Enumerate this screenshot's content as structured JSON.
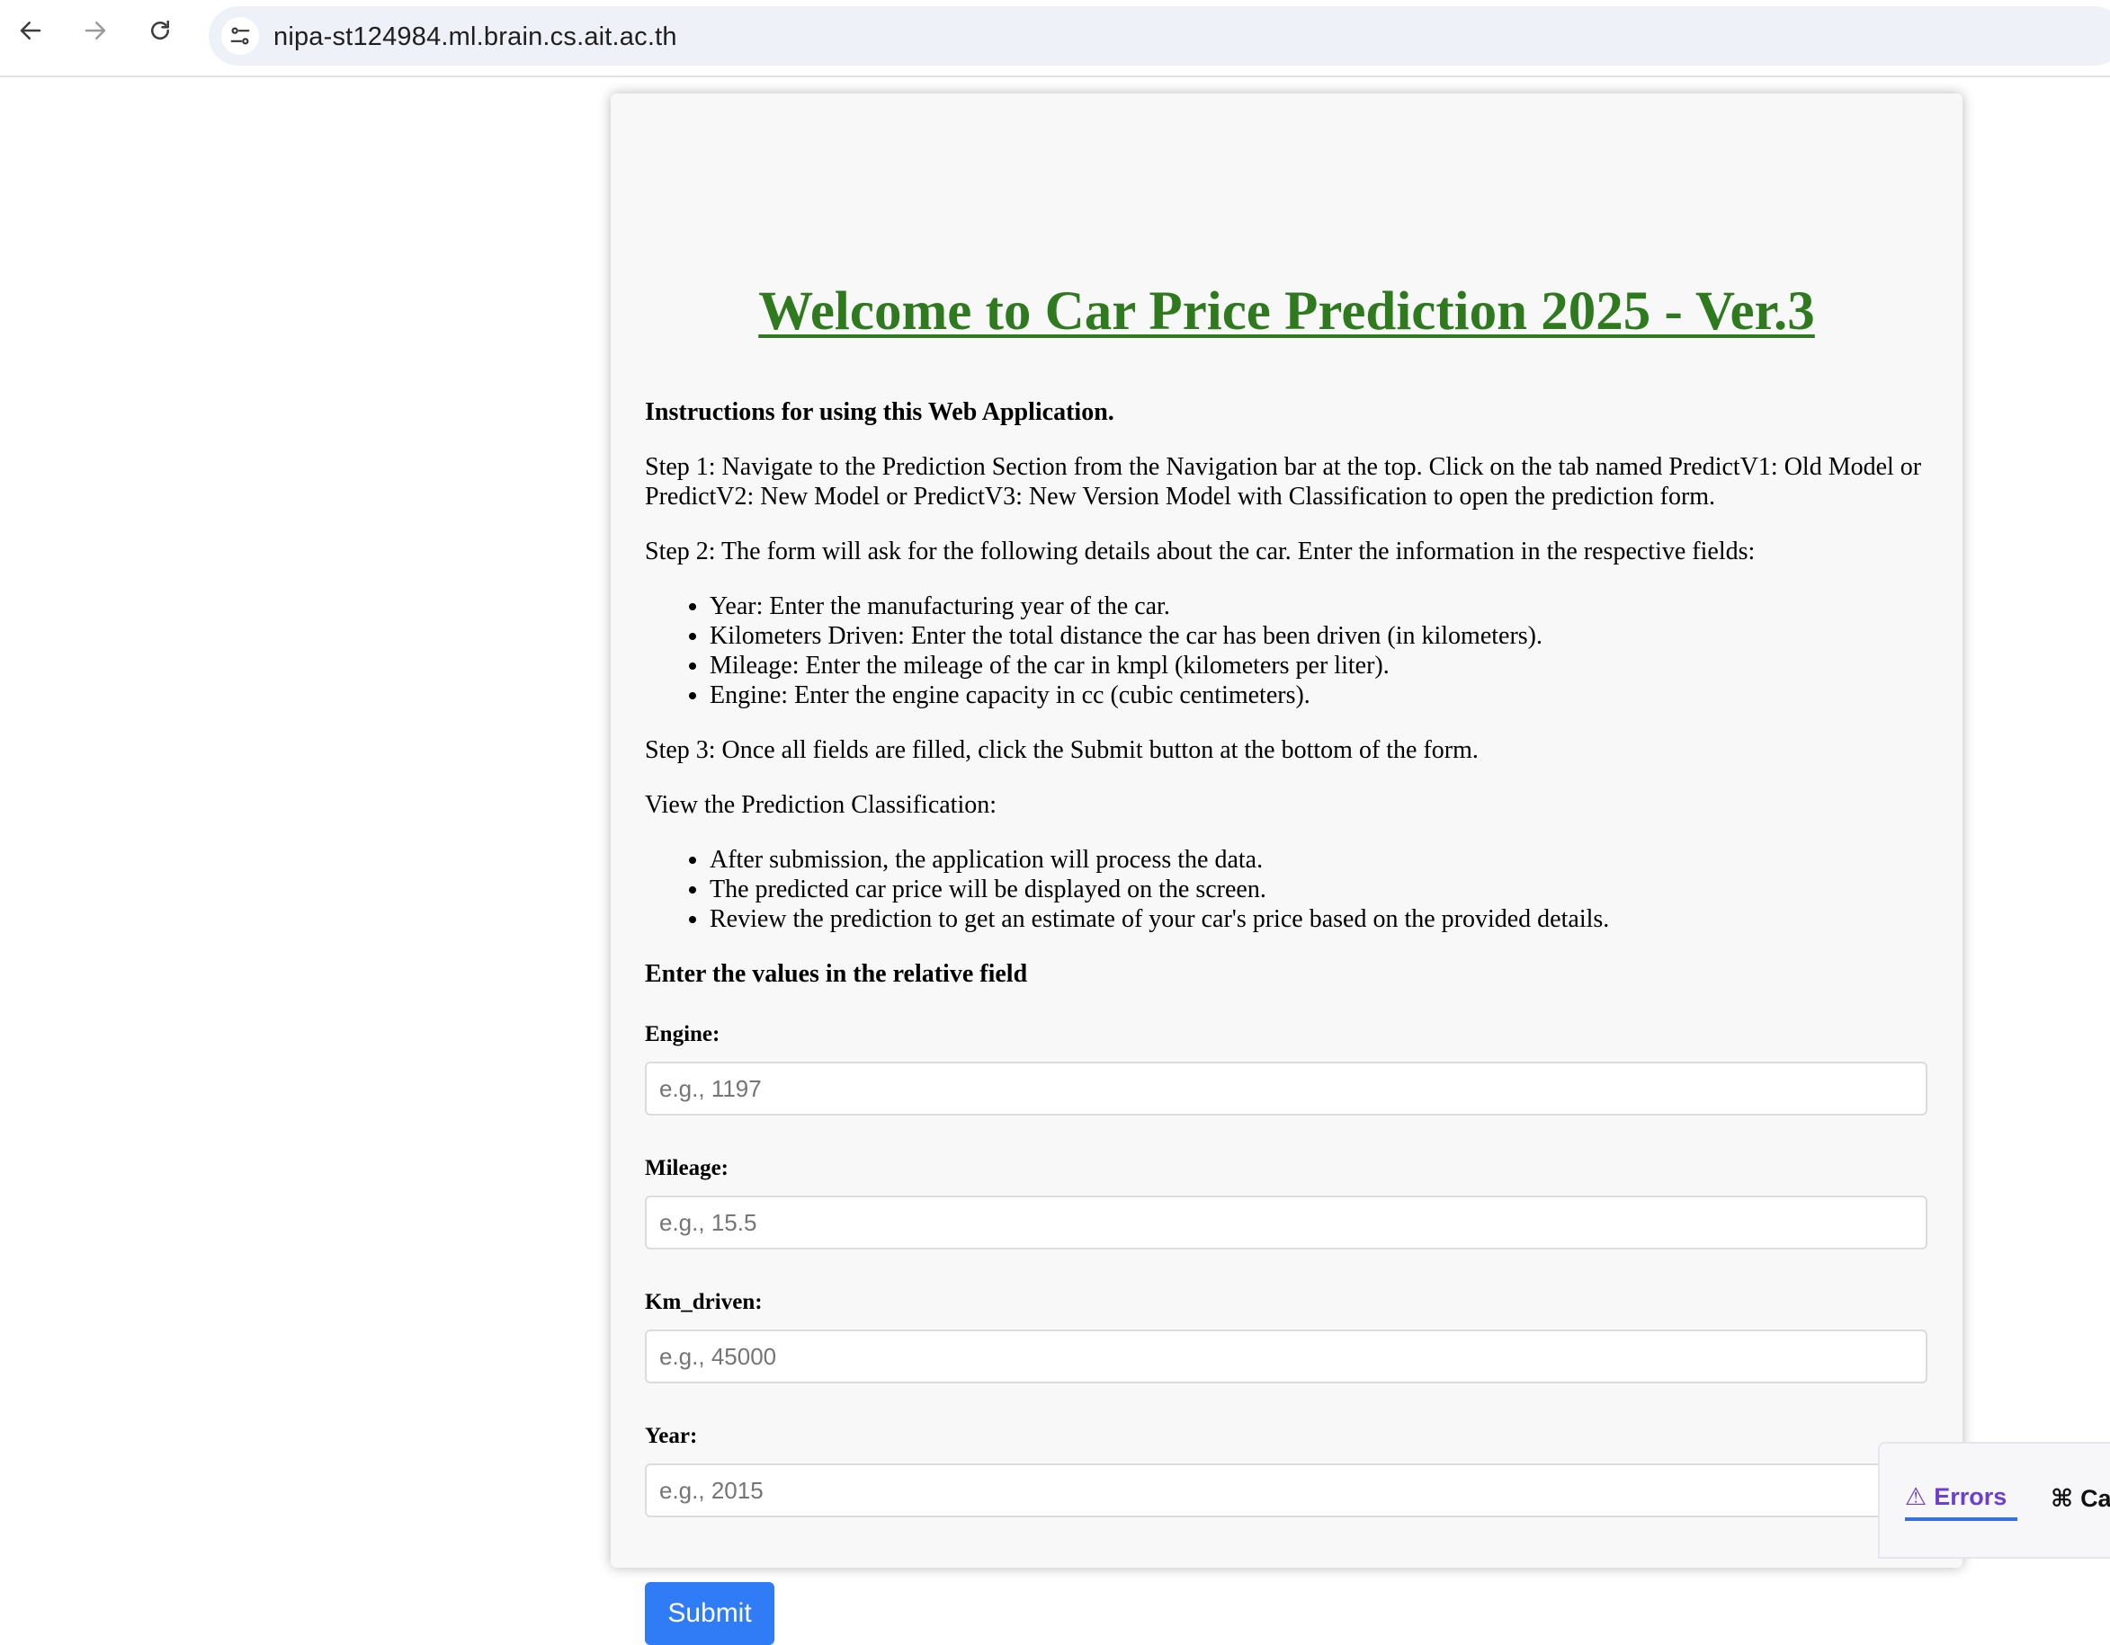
{
  "browser": {
    "url": "nipa-st124984.ml.brain.cs.ait.ac.th",
    "icons": [
      "back-arrow-icon",
      "forward-arrow-icon",
      "reload-icon",
      "site-settings-icon"
    ]
  },
  "page": {
    "title": "Welcome to Car Price Prediction 2025 - Ver.3",
    "title_color": "#2f7a1f",
    "instructions_heading": "Instructions for using this Web Application.",
    "step1": "Step 1: Navigate to the Prediction Section from the Navigation bar at the top. Click on the tab named PredictV1: Old Model or PredictV2: New Model or PredictV3: New Version Model with Classification to open the prediction form.",
    "step2": "Step 2: The form will ask for the following details about the car. Enter the information in the respective fields:",
    "step2_items": [
      "Year: Enter the manufacturing year of the car.",
      "Kilometers Driven: Enter the total distance the car has been driven (in kilometers).",
      "Mileage: Enter the mileage of the car in kmpl (kilometers per liter).",
      "Engine: Enter the engine capacity in cc (cubic centimeters)."
    ],
    "step3": "Step 3: Once all fields are filled, click the Submit button at the bottom of the form.",
    "view_heading": "View the Prediction Classification:",
    "view_items": [
      "After submission, the application will process the data.",
      "The predicted car price will be displayed on the screen.",
      "Review the prediction to get an estimate of your car's price based on the provided details."
    ],
    "form_heading": "Enter the values in the relative field"
  },
  "form": {
    "fields": [
      {
        "label": "Engine:",
        "placeholder": "e.g., 1197",
        "value": ""
      },
      {
        "label": "Mileage:",
        "placeholder": "e.g., 15.5",
        "value": ""
      },
      {
        "label": "Km_driven:",
        "placeholder": "e.g., 45000",
        "value": ""
      },
      {
        "label": "Year:",
        "placeholder": "e.g., 2015",
        "value": ""
      }
    ],
    "submit_label": "Submit",
    "submit_color": "#2f7cf6"
  },
  "dev_panel": {
    "errors_label": "Errors",
    "errors_icon": "warning-icon",
    "cal_label": "Cal",
    "cal_icon": "callback-icon",
    "accent": "#6b3fcf"
  }
}
